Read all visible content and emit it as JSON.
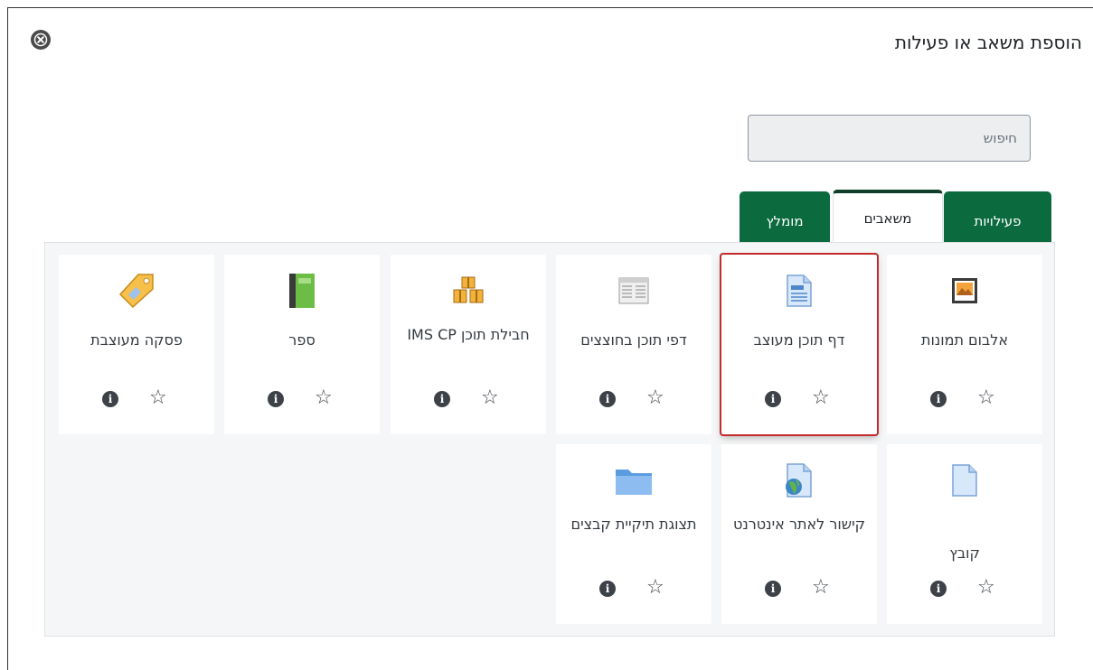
{
  "dialog": {
    "title": "הוספת משאב או פעילות",
    "search_placeholder": "חיפוש"
  },
  "tabs": [
    {
      "label": "פעילויות"
    },
    {
      "label": "משאבים"
    },
    {
      "label": "מומלץ"
    }
  ],
  "cards": [
    {
      "label": "אלבום תמונות",
      "icon": "image-gallery-icon"
    },
    {
      "label": "דף תוכן מעוצב",
      "icon": "page-icon"
    },
    {
      "label": "דפי תוכן בחוצצים",
      "icon": "tabbed-pages-icon"
    },
    {
      "label": "חבילת תוכן IMS CP",
      "icon": "ims-package-icon"
    },
    {
      "label": "ספר",
      "icon": "book-icon"
    },
    {
      "label": "פסקה מעוצבת",
      "icon": "label-tag-icon"
    },
    {
      "label": "קובץ",
      "icon": "file-icon"
    },
    {
      "label": "קישור לאתר אינטרנט",
      "icon": "url-icon"
    },
    {
      "label": "תצוגת תיקיית קבצים",
      "icon": "folder-icon"
    }
  ],
  "colors": {
    "brand_green": "#0b6b3f",
    "highlight_red": "#c42a2a"
  }
}
